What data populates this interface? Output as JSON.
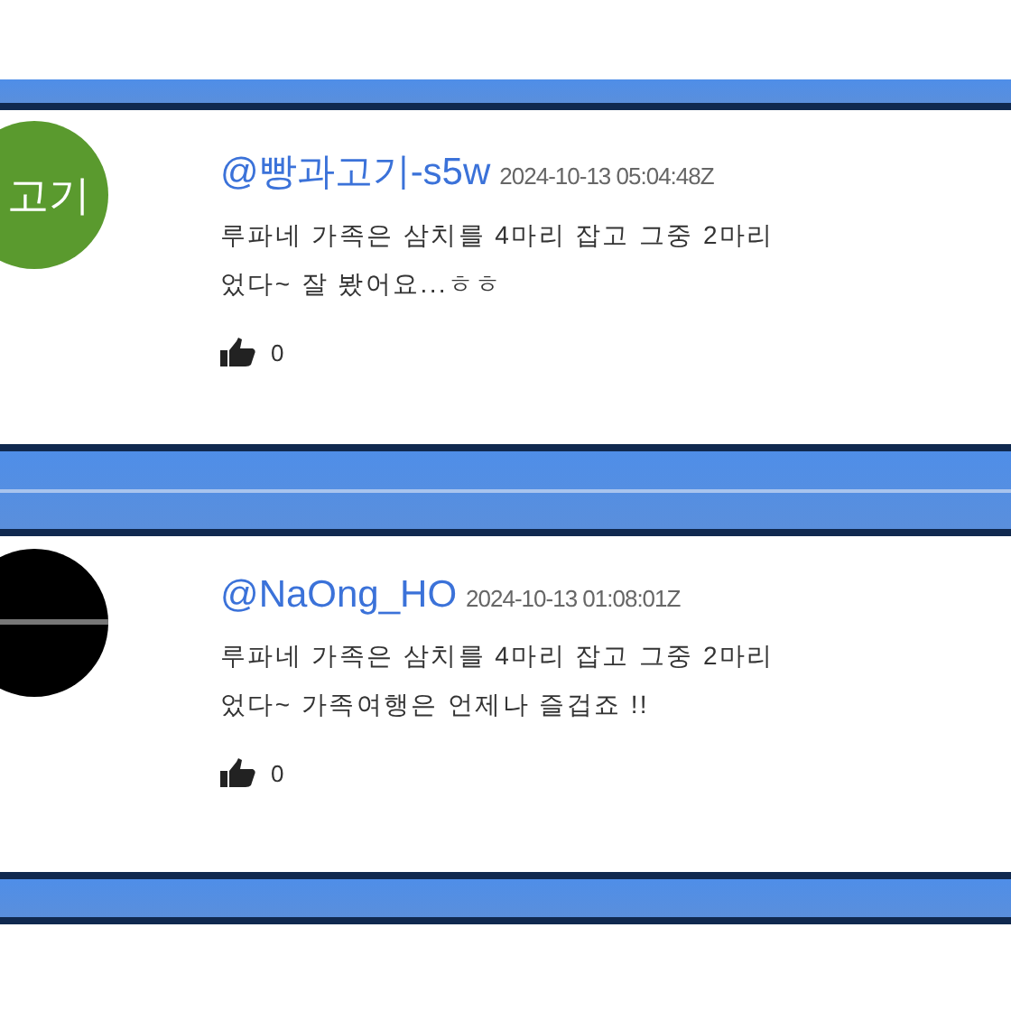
{
  "comments": [
    {
      "avatar": {
        "kind": "text",
        "text": "고기",
        "color": "#5a9a2e"
      },
      "username": "@빵과고기-s5w",
      "timestamp": "2024-10-13 05:04:48Z",
      "lines": [
        "루파네 가족은 삼치를 4마리 잡고 그중 2마리",
        "었다~ 잘 봤어요...ㅎㅎ"
      ],
      "likes": "0"
    },
    {
      "avatar": {
        "kind": "line",
        "color": "#000000"
      },
      "username": "@NaOng_HO",
      "timestamp": "2024-10-13 01:08:01Z",
      "lines": [
        "루파네 가족은 삼치를 4마리 잡고 그중 2마리",
        "었다~ 가족여행은 언제나 즐겁죠 !!"
      ],
      "likes": "0"
    }
  ]
}
